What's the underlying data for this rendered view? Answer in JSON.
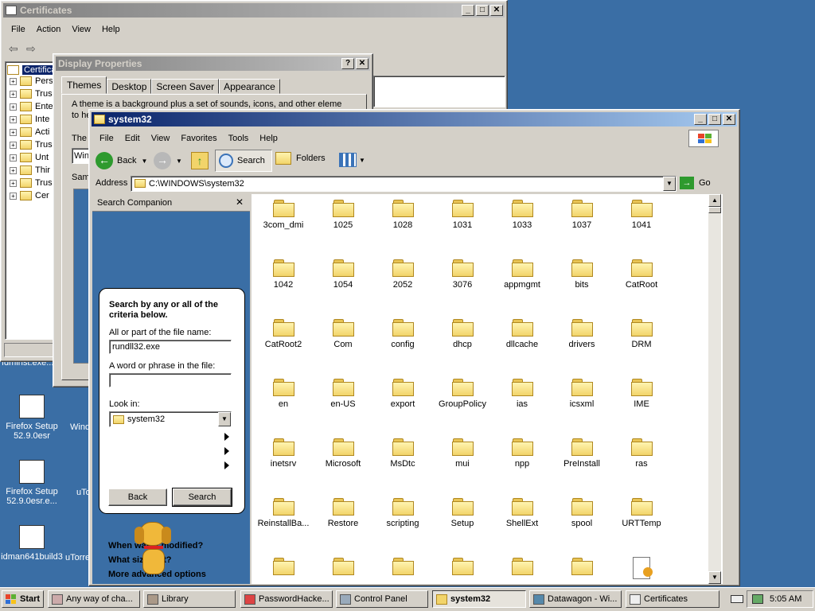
{
  "certificates": {
    "title": "Certificates",
    "menu": [
      "File",
      "Action",
      "View",
      "Help"
    ],
    "tree_root": "Certifica",
    "tree_items": [
      "Pers",
      "Trus",
      "Ente",
      "Inte",
      "Acti",
      "Trus",
      "Unt",
      "Thir",
      "Trus",
      "Cer"
    ]
  },
  "display": {
    "title": "Display Properties",
    "tabs": [
      "Themes",
      "Desktop",
      "Screen Saver",
      "Appearance"
    ],
    "desc": "A theme is a background plus a set of sounds, icons, and other elements",
    "desc2": "to he",
    "theme_label": "The",
    "theme_value": "Win",
    "sample_label": "Sam"
  },
  "explorer": {
    "title": "system32",
    "menu": [
      "File",
      "Edit",
      "View",
      "Favorites",
      "Tools",
      "Help"
    ],
    "back": "Back",
    "search": "Search",
    "folders": "Folders",
    "address_label": "Address",
    "address": "C:\\WINDOWS\\system32",
    "go": "Go",
    "companion": {
      "title": "Search Companion",
      "heading": "Search by any or all of the criteria below.",
      "filename_label": "All or part of the file name:",
      "filename_value": "rundll32.exe",
      "phrase_label": "A word or phrase in the file:",
      "phrase_value": "",
      "lookin_label": "Look in:",
      "lookin_value": "system32",
      "opt1": "When was it modified?",
      "opt2": "What size is it?",
      "opt3": "More advanced options",
      "back_btn": "Back",
      "search_btn": "Search"
    },
    "files": [
      "3com_dmi",
      "1025",
      "1028",
      "1031",
      "1033",
      "1037",
      "1041",
      "1042",
      "1054",
      "2052",
      "3076",
      "appmgmt",
      "bits",
      "CatRoot",
      "CatRoot2",
      "Com",
      "config",
      "dhcp",
      "dllcache",
      "drivers",
      "DRM",
      "en",
      "en-US",
      "export",
      "GroupPolicy",
      "ias",
      "icsxml",
      "IME",
      "inetsrv",
      "Microsoft",
      "MsDtc",
      "mui",
      "npp",
      "PreInstall",
      "ras",
      "ReinstallBa...",
      "Restore",
      "scripting",
      "Setup",
      "ShellExt",
      "spool",
      "URTTemp"
    ]
  },
  "desktop": {
    "fdminst": "fdminst.exe...",
    "icons": [
      {
        "label": "Firefox Setup 52.9.0esr"
      },
      {
        "label": "Firefox Setup 52.9.0esr.e..."
      },
      {
        "label": "idman641build3"
      }
    ],
    "partial": [
      "Wind",
      "uTo",
      "uTorre"
    ]
  },
  "taskbar": {
    "start": "Start",
    "items": [
      "Any way of cha...",
      "Library",
      "PasswordHacke...",
      "Control Panel",
      "system32",
      "Datawagon - Wi...",
      "Certificates"
    ],
    "clock": "5:05 AM"
  },
  "colors": {
    "desktop": "#3a6ea5",
    "active_title": "#0a246a",
    "companion_bg": "#3a6ea5"
  }
}
